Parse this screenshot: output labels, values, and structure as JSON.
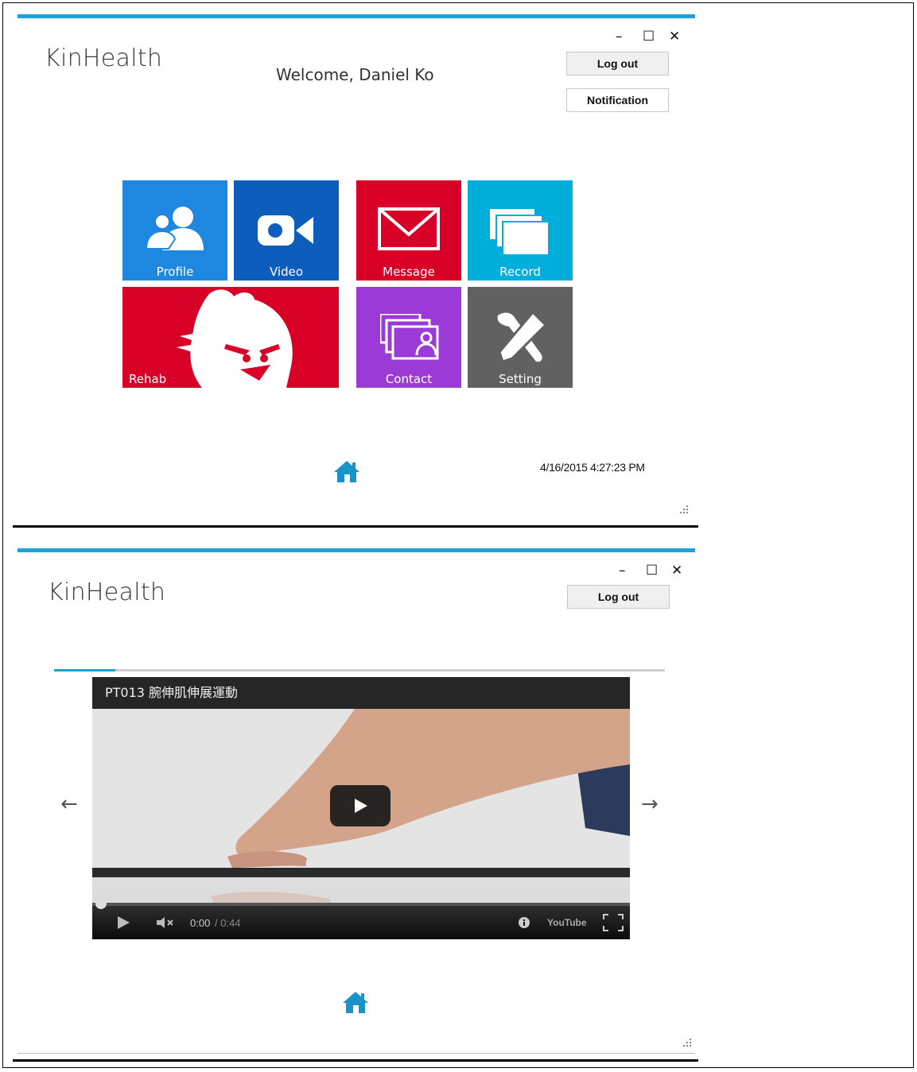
{
  "app": {
    "name": "KinHealth"
  },
  "window_controls": {
    "minimize": "–",
    "maximize": "☐",
    "close": "✕"
  },
  "home_screen": {
    "welcome": "Welcome, Daniel Ko",
    "logout_label": "Log out",
    "notification_label": "Notification",
    "tiles": [
      {
        "label": "Profile",
        "color": "#1e88e0",
        "icon": "people-icon"
      },
      {
        "label": "Video",
        "color": "#0d5dbd",
        "icon": "video-camera-icon"
      },
      {
        "label": "Message",
        "color": "#d80027",
        "icon": "envelope-icon"
      },
      {
        "label": "Record",
        "color": "#00aedb",
        "icon": "stacked-cards-icon"
      },
      {
        "label": "Rehab",
        "color": "#d80027",
        "icon": "angry-bird-icon"
      },
      {
        "label": "Contact",
        "color": "#9b3ad6",
        "icon": "contact-card-icon"
      },
      {
        "label": "Setting",
        "color": "#616161",
        "icon": "tools-icon"
      }
    ],
    "datetime": "4/16/2015 4:27:23 PM"
  },
  "video_screen": {
    "logout_label": "Log out",
    "progress_fraction": 0.1,
    "video": {
      "title": "PT013 腕伸肌伸展運動",
      "current_time": "0:00",
      "duration": "/ 0:44",
      "youtube_label": "YouTube"
    },
    "prev_arrow": "←",
    "next_arrow": "→"
  },
  "colors": {
    "accent": "#1ea1d6"
  }
}
